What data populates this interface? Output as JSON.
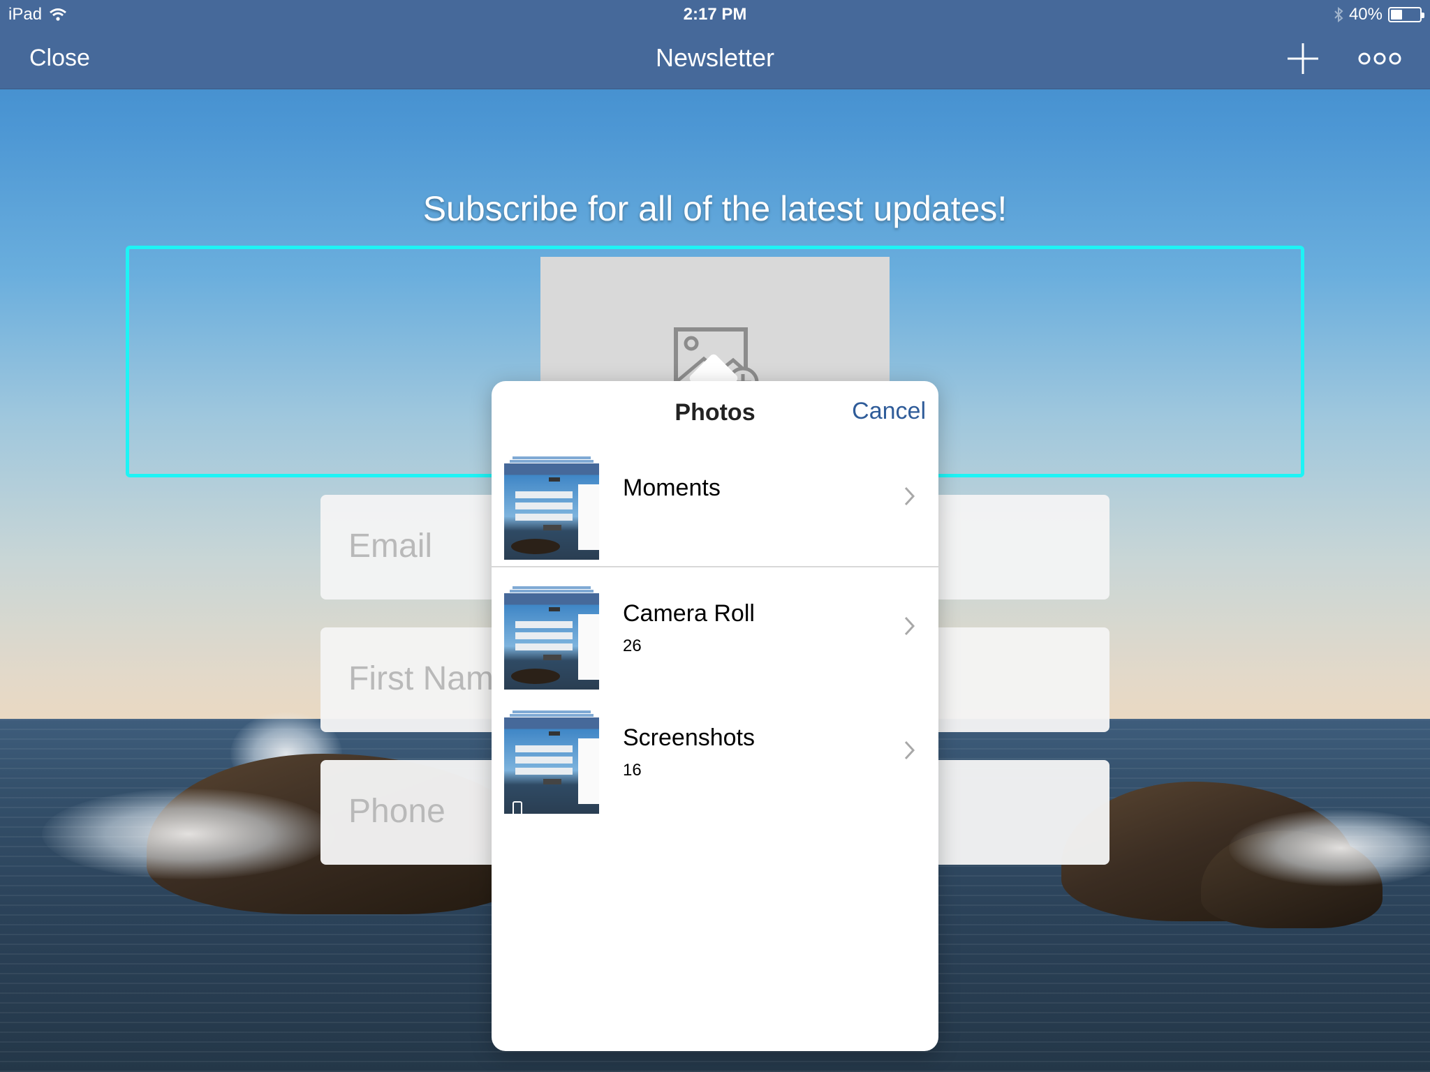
{
  "status_bar": {
    "device": "iPad",
    "time": "2:17 PM",
    "battery_percent": "40%",
    "battery_level": 0.4,
    "icons": [
      "wifi-icon",
      "bluetooth-icon",
      "battery-icon"
    ]
  },
  "nav": {
    "close_label": "Close",
    "title": "Newsletter",
    "add_icon": "plus-icon",
    "more_icon": "more-dots-icon"
  },
  "page": {
    "headline": "Subscribe for all of the latest updates!",
    "image_placeholder_icon": "add-image-icon",
    "accent_color": "#1ef3f5",
    "fields": {
      "email_placeholder": "Email",
      "first_name_placeholder": "First Nam",
      "phone_placeholder": "Phone"
    }
  },
  "photos_picker": {
    "title": "Photos",
    "cancel_label": "Cancel",
    "albums": [
      {
        "name": "Moments",
        "count": ""
      },
      {
        "name": "Camera Roll",
        "count": "26"
      },
      {
        "name": "Screenshots",
        "count": "16"
      }
    ]
  },
  "colors": {
    "nav_bar": "#46699a",
    "cancel_link": "#2f5c99"
  }
}
